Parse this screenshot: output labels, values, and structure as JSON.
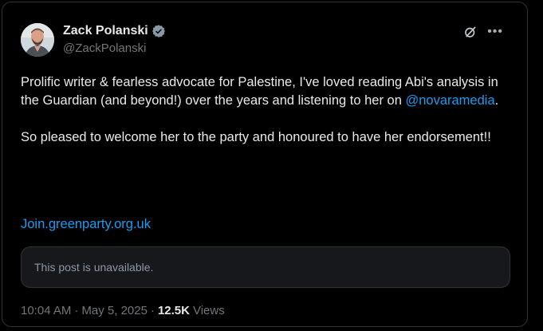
{
  "author": {
    "name": "Zack Polanski",
    "handle": "@ZackPolanski",
    "verified": true
  },
  "post": {
    "line1_pre": "Prolific writer & fearless advocate for Palestine, I've loved reading Abi's analysis in the Guardian (and beyond!) over the years and listening to her on ",
    "mention": "@novaramedia",
    "line1_post": ".",
    "paragraph2": "So pleased to welcome her to the party and honoured to have her endorsement!!",
    "link": "Join.greenparty.org.uk"
  },
  "quoted": {
    "text": "This post is unavailable."
  },
  "meta": {
    "time": "10:04 AM",
    "separator": "·",
    "date": "May 5, 2025",
    "views_count": "12.5K",
    "views_label": "Views"
  },
  "icons": {
    "verified": "verified-badge-icon",
    "grok": "grok-icon",
    "more": "more-icon"
  },
  "colors": {
    "background": "#000000",
    "text": "#e7e9ea",
    "secondary": "#71767b",
    "link": "#1d9bf0",
    "border": "#2f3336"
  }
}
